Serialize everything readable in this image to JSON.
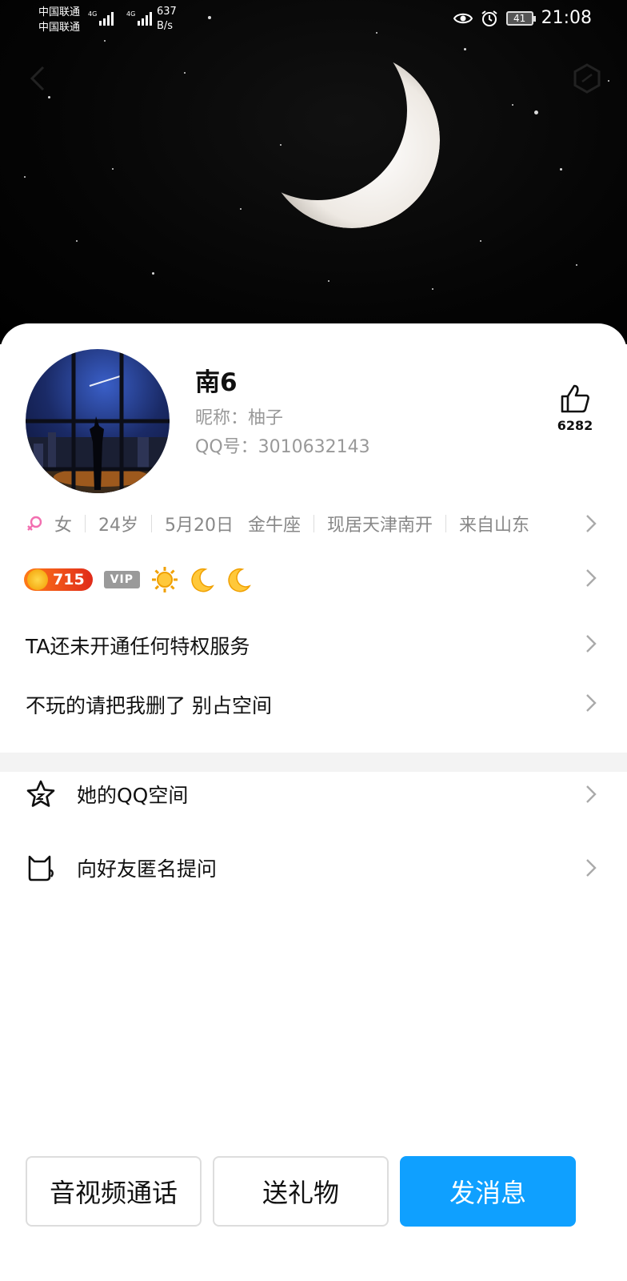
{
  "status_bar": {
    "carrier_1": "中国联通",
    "carrier_2": "中国联通",
    "net_1": "4G",
    "net_2": "4G",
    "speed_value": "637",
    "speed_unit": "B/s",
    "battery": "41",
    "time": "21:08"
  },
  "profile": {
    "name": "南6",
    "nickname": "昵称：柚子",
    "qq": "QQ号：3010632143",
    "likes": "6282"
  },
  "info": {
    "gender": "女",
    "age": "24岁",
    "birthday": "5月20日",
    "zodiac": "金牛座",
    "residence": "现居天津南开",
    "hometown": "来自山东"
  },
  "badges": {
    "level": "715",
    "vip_label": "VIP"
  },
  "rows": {
    "privilege": "TA还未开通任何特权服务",
    "signature": "不玩的请把我删了 别占空间"
  },
  "menu": {
    "qzone": "她的QQ空间",
    "anon_ask": "向好友匿名提问"
  },
  "actions": {
    "call": "音视频通话",
    "gift": "送礼物",
    "message": "发消息"
  },
  "colors": {
    "primary": "#0fa0ff",
    "level_badge": "#ff6a1a",
    "gender_female": "#f26fb0"
  }
}
